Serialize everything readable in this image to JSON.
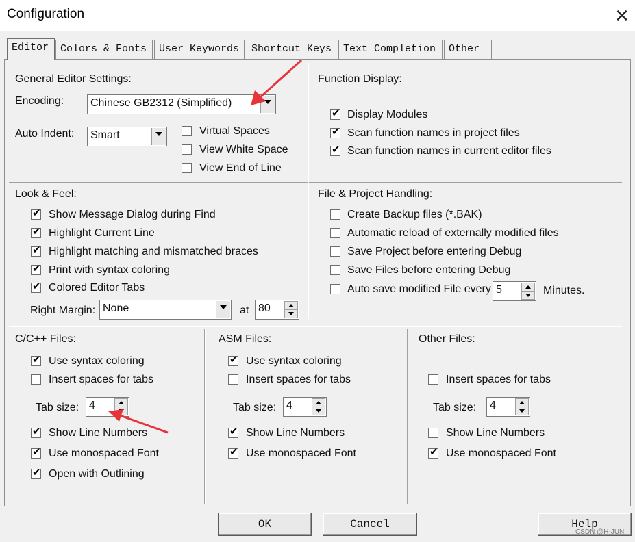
{
  "window": {
    "title": "Configuration",
    "close_icon": "close-icon"
  },
  "tabs": [
    "Editor",
    "Colors & Fonts",
    "User Keywords",
    "Shortcut Keys",
    "Text Completion",
    "Other"
  ],
  "general": {
    "heading": "General Editor Settings:",
    "encoding_label": "Encoding:",
    "encoding_value": "Chinese GB2312 (Simplified)",
    "auto_indent_label": "Auto Indent:",
    "auto_indent_value": "Smart",
    "options": [
      {
        "label": "Virtual Spaces",
        "checked": false
      },
      {
        "label": "View White Space",
        "checked": false
      },
      {
        "label": "View End of Line",
        "checked": false
      }
    ]
  },
  "function_display": {
    "heading": "Function Display:",
    "options": [
      {
        "label": "Display Modules",
        "checked": true
      },
      {
        "label": "Scan function names in project files",
        "checked": true
      },
      {
        "label": "Scan function names in current editor files",
        "checked": true
      }
    ]
  },
  "look_feel": {
    "heading": "Look & Feel:",
    "options": [
      {
        "label": "Show Message Dialog during Find",
        "checked": true
      },
      {
        "label": "Highlight Current Line",
        "checked": true
      },
      {
        "label": "Highlight matching and mismatched braces",
        "checked": true
      },
      {
        "label": "Print with syntax coloring",
        "checked": true
      },
      {
        "label": "Colored Editor Tabs",
        "checked": true
      }
    ],
    "right_margin_label": "Right Margin:",
    "right_margin_value": "None",
    "at_label": "at",
    "at_value": "80"
  },
  "file_project": {
    "heading": "File & Project Handling:",
    "options": [
      {
        "label": "Create Backup files (*.BAK)",
        "checked": false
      },
      {
        "label": "Automatic reload of externally modified files",
        "checked": false
      },
      {
        "label": "Save Project before entering Debug",
        "checked": false
      },
      {
        "label": "Save Files before entering Debug",
        "checked": false
      }
    ],
    "autosave_label": "Auto save modified File every",
    "autosave_checked": false,
    "autosave_value": "5",
    "minutes_label": "Minutes."
  },
  "cpp_files": {
    "heading": "C/C++ Files:",
    "syntax": {
      "label": "Use syntax coloring",
      "checked": true
    },
    "spaces": {
      "label": "Insert spaces for tabs",
      "checked": false
    },
    "tab_size_label": "Tab size:",
    "tab_size_value": "4",
    "line_numbers": {
      "label": "Show Line Numbers",
      "checked": true
    },
    "monospaced": {
      "label": "Use monospaced Font",
      "checked": true
    },
    "outlining": {
      "label": "Open with Outlining",
      "checked": true
    }
  },
  "asm_files": {
    "heading": "ASM Files:",
    "syntax": {
      "label": "Use syntax coloring",
      "checked": true
    },
    "spaces": {
      "label": "Insert spaces for tabs",
      "checked": false
    },
    "tab_size_label": "Tab size:",
    "tab_size_value": "4",
    "line_numbers": {
      "label": "Show Line Numbers",
      "checked": true
    },
    "monospaced": {
      "label": "Use monospaced Font",
      "checked": true
    }
  },
  "other_files": {
    "heading": "Other Files:",
    "spaces": {
      "label": "Insert spaces for tabs",
      "checked": false
    },
    "tab_size_label": "Tab size:",
    "tab_size_value": "4",
    "line_numbers": {
      "label": "Show Line Numbers",
      "checked": false
    },
    "monospaced": {
      "label": "Use monospaced Font",
      "checked": true
    }
  },
  "buttons": {
    "ok": "OK",
    "cancel": "Cancel",
    "help": "Help"
  },
  "watermark": "CSDN @H-JUN",
  "annotation_color": "#e8333b",
  "checkmark": "✔"
}
